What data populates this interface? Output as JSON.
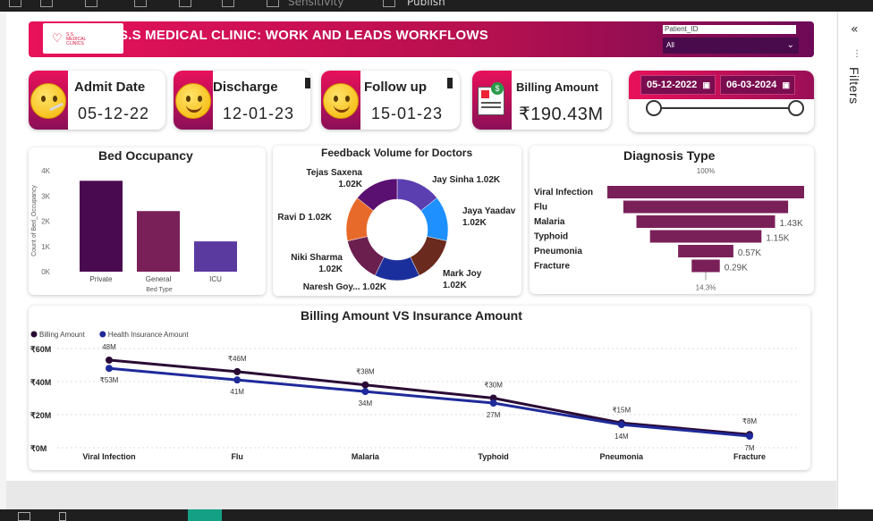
{
  "toolbar": {
    "sensitivity_label": "Sensitivity",
    "publish_label": "Publish"
  },
  "header": {
    "logo_text": "S.S MEDICAL CLINICS",
    "title": "S.S MEDICAL CLINIC: WORK AND LEADS WORKFLOWS",
    "patient_slicer": {
      "label": "Patient_ID",
      "value": "All"
    }
  },
  "kpis": [
    {
      "title": "Admit Date",
      "value": "05-12-22"
    },
    {
      "title": "Discharge",
      "value": "12-01-23"
    },
    {
      "title": "Follow up",
      "value": "15-01-23"
    },
    {
      "title": "Billing Amount",
      "value": "₹190.43M"
    }
  ],
  "date_range": {
    "start": "05-12-2022",
    "end": "06-03-2024",
    "slider_start": 0.0,
    "slider_end": 1.0
  },
  "filters_pane": {
    "label": "Filters"
  },
  "chart_data": [
    {
      "type": "bar",
      "title": "Bed Occupancy",
      "xlabel": "Bed Type",
      "ylabel": "Count of Bed_Occupancy",
      "categories": [
        "Private",
        "General",
        "ICU"
      ],
      "values": [
        3.6,
        2.4,
        1.2
      ],
      "ylim": [
        0,
        4
      ],
      "yticks": [
        "0K",
        "1K",
        "2K",
        "3K",
        "4K"
      ],
      "colors": [
        "#4a0a4f",
        "#7a2059",
        "#5b3aa0"
      ]
    },
    {
      "type": "pie",
      "title": "Feedback Volume for Doctors",
      "slices": [
        {
          "label": "Jay Sinha 1.02K",
          "value": 1.02,
          "color": "#5b3fb0"
        },
        {
          "label": "Jaya Yaadav 1.02K",
          "value": 1.02,
          "color": "#1e90ff"
        },
        {
          "label": "Mark Joy 1.02K",
          "value": 1.02,
          "color": "#6b2a1e"
        },
        {
          "label": "Naresh Goy... 1.02K",
          "value": 1.02,
          "color": "#1b2f9c"
        },
        {
          "label": "Niki Sharma 1.02K",
          "value": 1.02,
          "color": "#6a1f4f"
        },
        {
          "label": "Ravi D 1.02K",
          "value": 1.02,
          "color": "#e86a2b"
        },
        {
          "label": "Tejas Saxena 1.02K",
          "value": 1.02,
          "color": "#5a1070"
        }
      ]
    },
    {
      "type": "bar",
      "title": "Diagnosis Type",
      "subtype": "funnel",
      "top_percent": "100%",
      "bottom_percent": "14.3%",
      "categories": [
        "Viral Infection",
        "Flu",
        "Malaria",
        "Typhoid",
        "Pneumonia",
        "Fracture"
      ],
      "values": [
        2.03,
        1.7,
        1.43,
        1.15,
        0.57,
        0.29
      ],
      "value_labels": [
        "",
        "",
        "1.43K",
        "1.15K",
        "0.57K",
        "0.29K"
      ],
      "color": "#7a2059"
    },
    {
      "type": "line",
      "title": "Billing Amount VS Insurance Amount",
      "categories": [
        "Viral Infection",
        "Flu",
        "Malaria",
        "Typhoid",
        "Pneumonia",
        "Fracture"
      ],
      "ylim": [
        0,
        60
      ],
      "yticks": [
        "₹0M",
        "₹20M",
        "₹40M",
        "₹60M"
      ],
      "series": [
        {
          "name": "Billing Amount",
          "values": [
            53,
            46,
            38,
            30,
            15,
            8
          ],
          "labels": [
            "48M",
            "₹46M",
            "₹38M",
            "₹30M",
            "₹15M",
            "₹8M"
          ],
          "color": "#2a0a35"
        },
        {
          "name": "Health Insurance Amount",
          "values": [
            48,
            41,
            34,
            27,
            14,
            7
          ],
          "labels": [
            "₹53M",
            "41M",
            "34M",
            "27M",
            "14M",
            "7M"
          ],
          "color": "#1f2a9a"
        }
      ]
    }
  ]
}
